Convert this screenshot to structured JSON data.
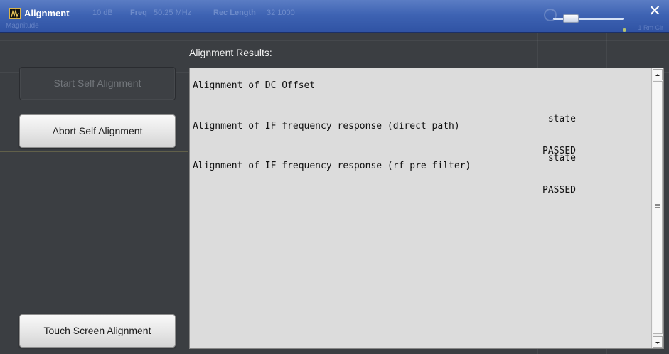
{
  "window": {
    "title": "Alignment",
    "close_glyph": "✕",
    "background_readouts": {
      "ref_level": "10 dB",
      "freq_label": "Freq",
      "freq_value": "50.25 MHz",
      "rec_length_label": "Rec Length",
      "rec_length_value": "32 1000",
      "trace_label": "Magnitude",
      "marker_label": "1 Rm Clr"
    }
  },
  "buttons": {
    "start_self_alignment": "Start Self Alignment",
    "abort_self_alignment": "Abort Self Alignment",
    "touch_screen_alignment": "Touch Screen Alignment"
  },
  "results": {
    "label": "Alignment Results:",
    "lines": [
      "Alignment of DC Offset",
      "Alignment of IF frequency response (direct path)",
      "Alignment of IF frequency response (rf pre filter)"
    ],
    "states": [
      {
        "label": "state",
        "value": "PASSED"
      },
      {
        "label": "state",
        "value": "PASSED"
      }
    ]
  },
  "colors": {
    "titlebar": "#3e63b3",
    "background": "#3b3e42",
    "results_bg": "#dcdcdc"
  },
  "icons": {
    "app": "rs-app-icon",
    "close": "close-icon",
    "scroll_up": "arrow-up-icon",
    "scroll_down": "arrow-down-icon",
    "scroll_grip": "grip-icon"
  }
}
